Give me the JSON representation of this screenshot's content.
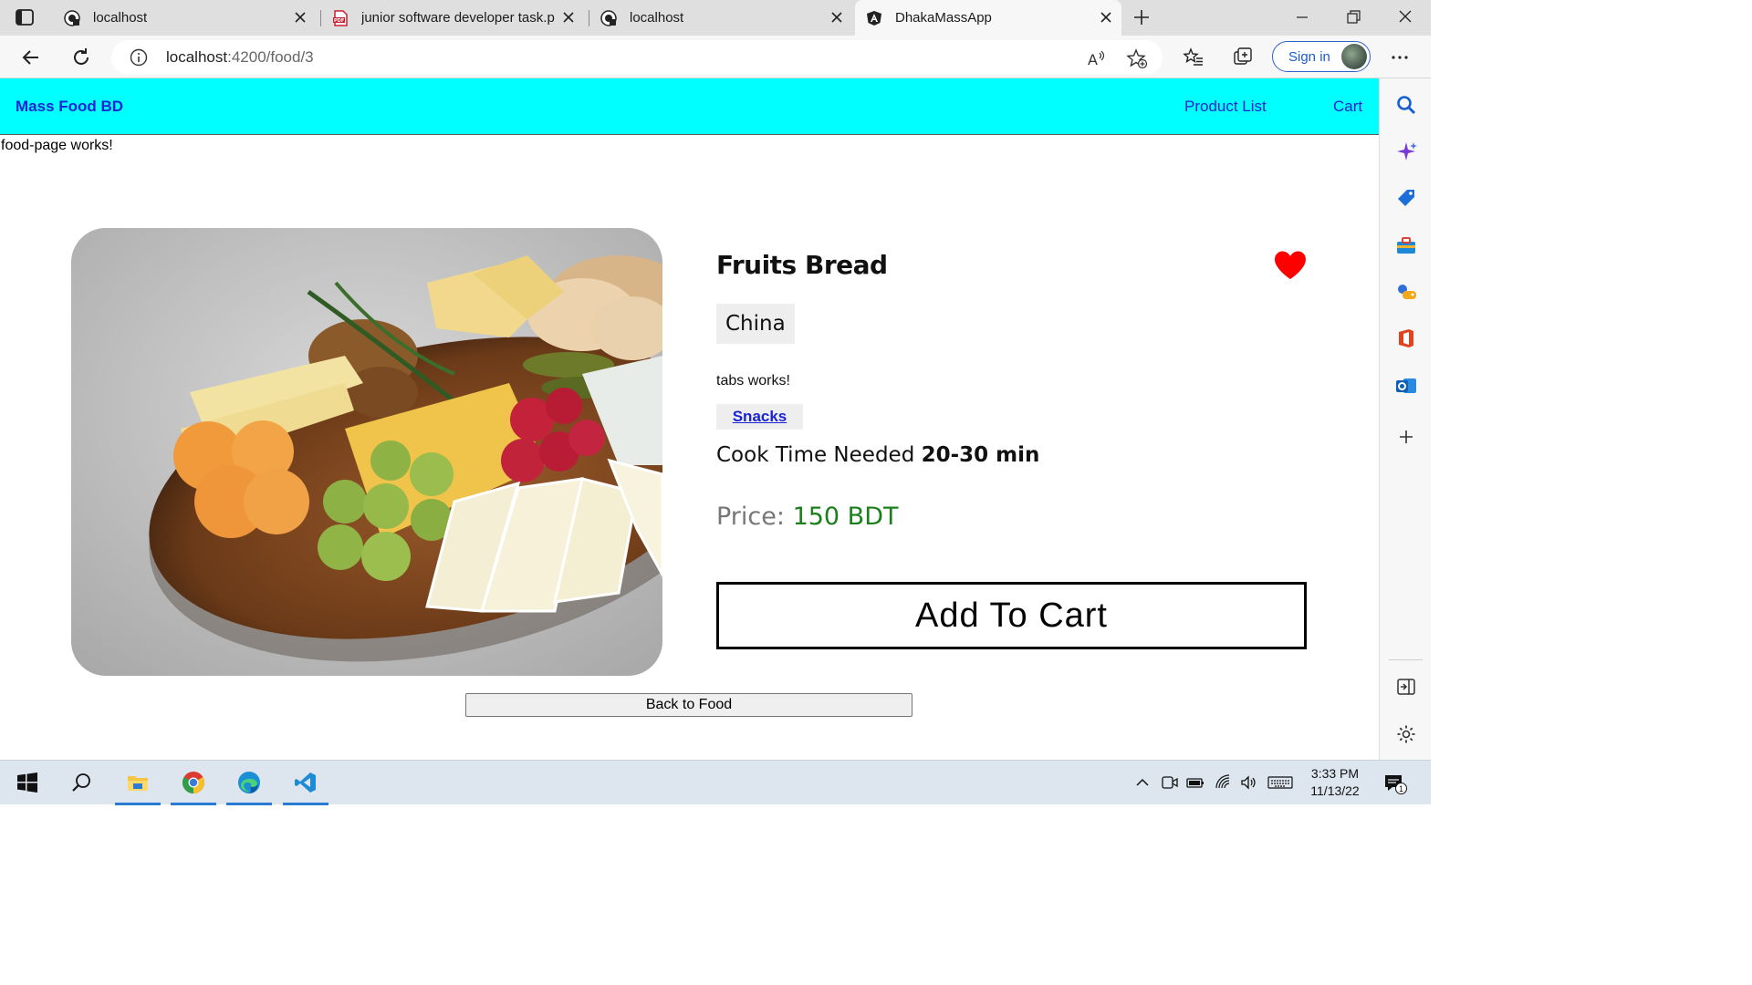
{
  "browser": {
    "tabs": [
      {
        "title": "localhost",
        "icon": "github-icon"
      },
      {
        "title": "junior software developer task.pdf",
        "icon": "pdf-icon"
      },
      {
        "title": "localhost",
        "icon": "github-icon"
      },
      {
        "title": "DhakaMassApp",
        "icon": "angular-icon",
        "active": true
      }
    ],
    "url_host": "localhost",
    "url_path": ":4200/food/3",
    "signin_label": "Sign in"
  },
  "app": {
    "brand": "Mass Food BD",
    "nav": [
      "Product List",
      "Cart"
    ],
    "page_works": "food-page works!"
  },
  "food": {
    "name": "Fruits Bread",
    "favorite": true,
    "origin": "China",
    "tabs_works": "tabs works!",
    "tags": [
      "Snacks"
    ],
    "cook_time_label": "Cook Time Needed",
    "cook_time": "20-30 min",
    "price_label": "Price:",
    "price": "150 BDT",
    "add_to_cart": "Add To Cart",
    "back": "Back to Food"
  },
  "taskbar": {
    "time": "3:33 PM",
    "date": "11/13/22",
    "notification_count": "1"
  },
  "colors": {
    "nav_bg": "#00ffff",
    "link": "#1a24d6",
    "price": "#1b7f1b",
    "heart": "#ff0000"
  }
}
